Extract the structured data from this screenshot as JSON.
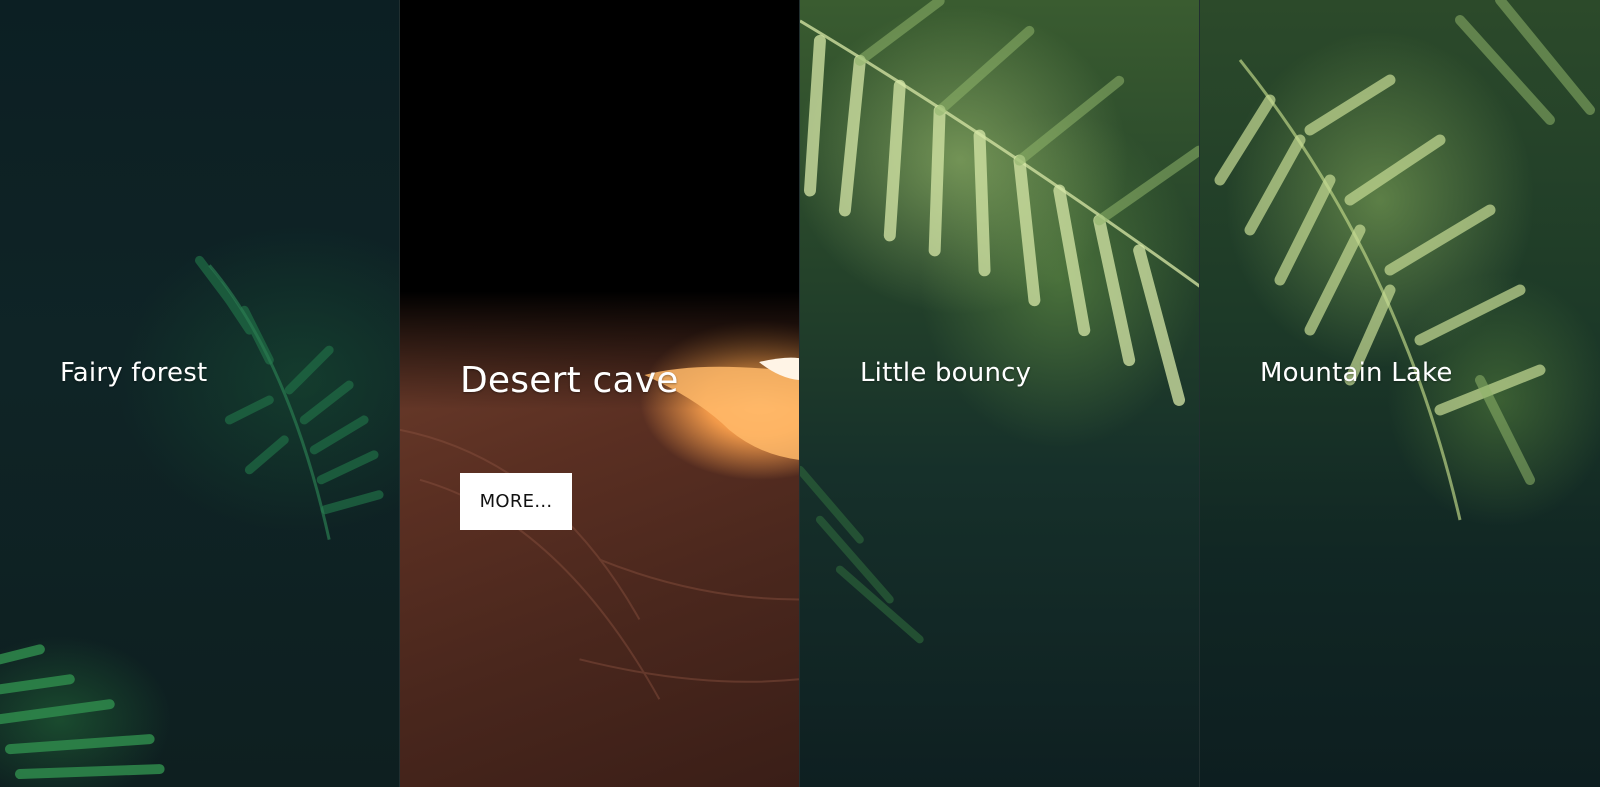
{
  "panels": [
    {
      "title": "Fairy forest",
      "active": false
    },
    {
      "title": "Desert cave",
      "active": true,
      "button_label": "MORE..."
    },
    {
      "title": "Little bouncy",
      "active": false
    },
    {
      "title": "Mountain Lake",
      "active": false
    }
  ],
  "colors": {
    "text": "#ffffff",
    "button_bg": "#ffffff",
    "button_text": "#111111"
  }
}
